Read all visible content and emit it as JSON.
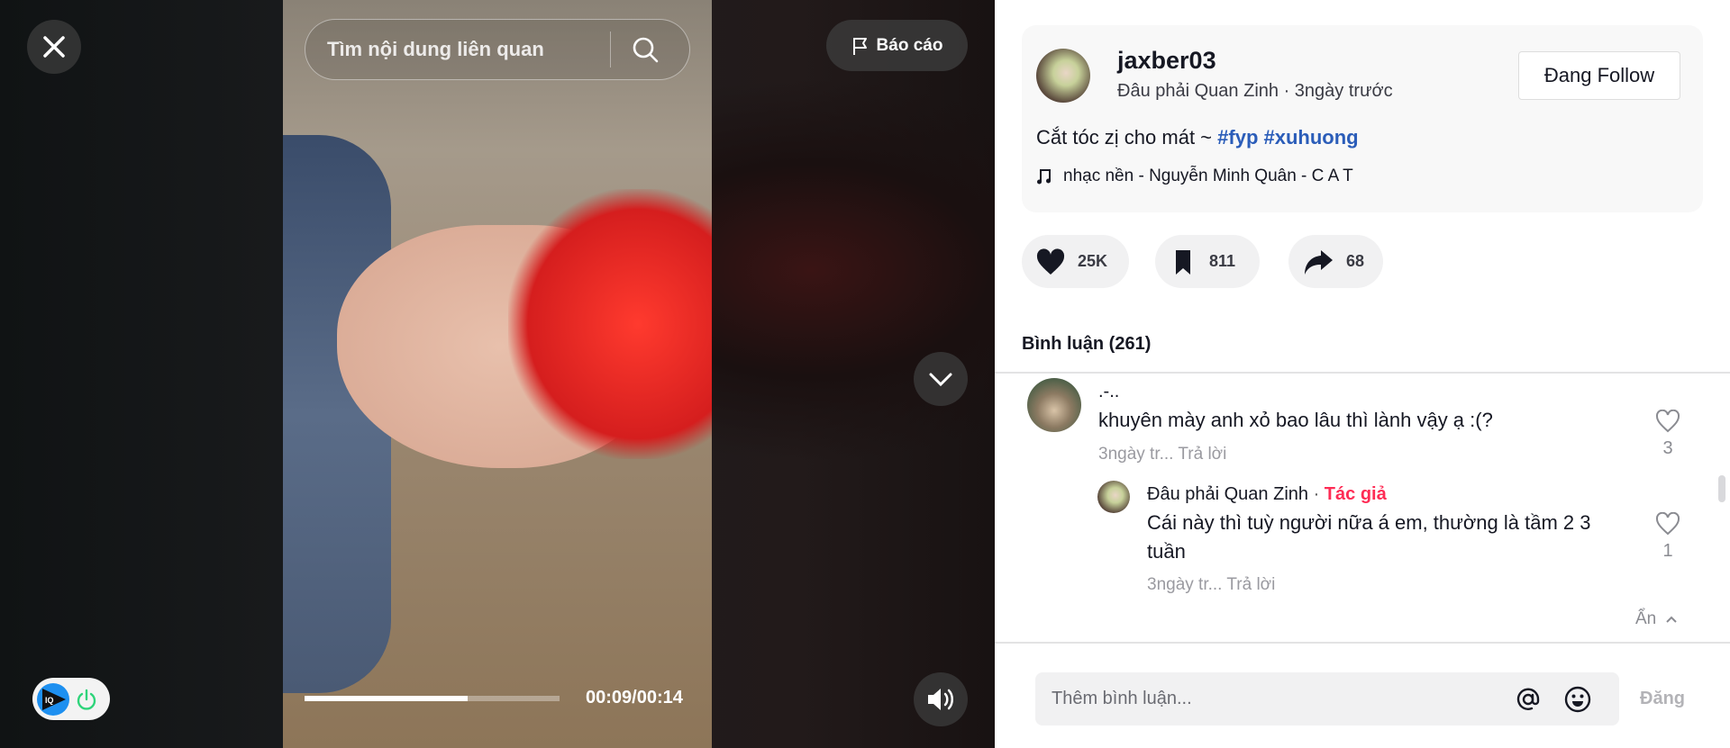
{
  "video": {
    "search_placeholder": "Tìm nội dung liên quan",
    "report_label": "Báo cáo",
    "progress": 0.64,
    "time": "00:09/00:14"
  },
  "extension": {
    "logo_text": "IQ"
  },
  "post": {
    "username": "jaxber03",
    "display_name": "Đâu phải Quan Zinh",
    "posted": "3ngày trước",
    "follow_label": "Đang Follow",
    "caption": "Cắt tóc zị cho mát ~ ",
    "hashtags": [
      "#fyp",
      "#xuhuong"
    ],
    "music": "nhạc nền - Nguyễn Minh Quân - C A T",
    "likes": "25K",
    "saves": "811",
    "shares": "68"
  },
  "comments": {
    "heading": "Bình luận (261)",
    "items": [
      {
        "name": ".-..",
        "text": "khuyên mày anh xỏ bao lâu thì lành vậy ạ :(?",
        "time": "3ngày tr...",
        "reply": "Trả lời",
        "likes": "3"
      }
    ],
    "replies": [
      {
        "name": "Đâu phải Quan Zinh",
        "sep": " · ",
        "badge": "Tác giả",
        "text": "Cái này thì tuỳ người nữa á em, thường là tầm 2 3 tuần",
        "time": "3ngày tr...",
        "reply": "Trả lời",
        "likes": "1"
      }
    ],
    "hide_label": "Ẩn",
    "input_placeholder": "Thêm bình luận...",
    "post_label": "Đăng"
  },
  "colors": {
    "hashtag": "#2b5db9",
    "author_badge": "#fe2c55",
    "power": "#2ed47a",
    "iq_blue": "#1e90f0"
  }
}
